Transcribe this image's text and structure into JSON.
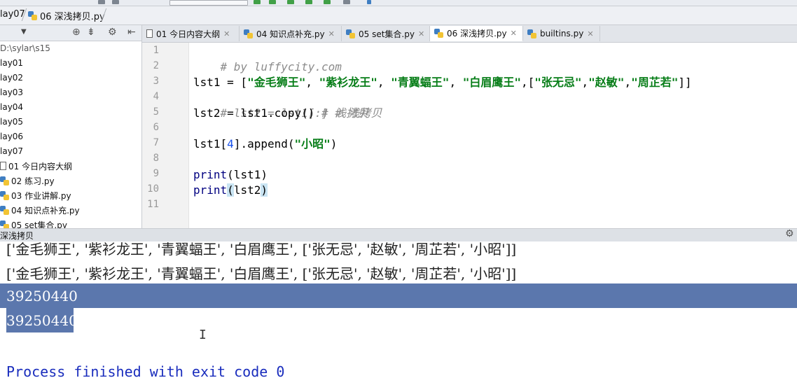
{
  "breadcrumb": {
    "folder": "lay07",
    "file": "06 深浅拷贝.py"
  },
  "project": {
    "root": "D:\\sylar\\s15",
    "folders": [
      "lay01",
      "lay02",
      "lay03",
      "lay04",
      "lay05",
      "lay06",
      "lay07"
    ],
    "files": [
      {
        "label": "01 今日内容大纲",
        "icon": "document-icon"
      },
      {
        "label": "02 练习.py",
        "icon": "python-file-icon"
      },
      {
        "label": "03 作业讲解.py",
        "icon": "python-file-icon"
      },
      {
        "label": "04 知识点补充.py",
        "icon": "python-file-icon"
      },
      {
        "label": "05 set集合.py",
        "icon": "python-file-icon"
      }
    ]
  },
  "tabs": [
    {
      "label": "01 今日内容大纲",
      "icon": "document-icon",
      "active": false
    },
    {
      "label": "04 知识点补充.py",
      "icon": "python-file-icon",
      "active": false
    },
    {
      "label": "05 set集合.py",
      "icon": "python-file-icon",
      "active": false
    },
    {
      "label": "06 深浅拷贝.py",
      "icon": "python-file-icon",
      "active": true
    },
    {
      "label": "builtins.py",
      "icon": "python-file-icon",
      "active": false
    }
  ],
  "editor": {
    "line_numbers": [
      "1",
      "2",
      "3",
      "4",
      "5",
      "6",
      "7",
      "8",
      "9",
      "10",
      "11"
    ],
    "lines": {
      "l1": "# by luffycity.com",
      "l3_a": "lst1 = [",
      "l3_s1": "\"金毛狮王\"",
      "l3_s2": "\"紫衫龙王\"",
      "l3_s3": "\"青翼蝠王\"",
      "l3_s4": "\"白眉鹰王\"",
      "l3_s5": "\"张无忌\"",
      "l3_s6": "\"赵敏\"",
      "l3_s7": "\"周芷若\"",
      "l4": "# lst2 = lst1[:] # 浅拷贝",
      "l5_a": "lst2 = lst1.copy() ",
      "l5_c": "# 浅拷贝",
      "l7_a": "lst1[",
      "l7_n": "4",
      "l7_b": "].append(",
      "l7_s": "\"小昭\"",
      "l7_c": ")",
      "l9_p": "print",
      "l9_r": "(lst1)",
      "l10_p": "print",
      "l10_o": "(",
      "l10_v": "lst2",
      "l10_c": ")"
    }
  },
  "run": {
    "title": "深浅拷贝"
  },
  "console": {
    "line1": "['金毛狮王', '紫衫龙王', '青翼蝠王', '白眉鹰王', ['张无忌', '赵敏', '周芷若', '小昭']]",
    "line2": "['金毛狮王', '紫衫龙王', '青翼蝠王', '白眉鹰王', ['张无忌', '赵敏', '周芷若', '小昭']]",
    "id1": "39250440",
    "id2": "39250440",
    "exit_msg": "Process finished with exit code 0"
  }
}
